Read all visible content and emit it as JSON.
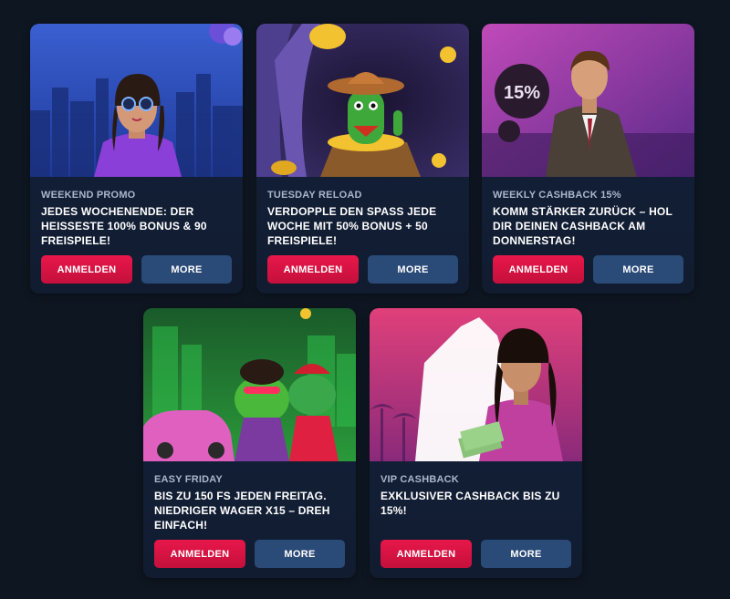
{
  "promotions": [
    {
      "tag": "WEEKEND PROMO",
      "title": "JEDES WOCHENENDE: DER HEISSESTE 100% BONUS & 90 FREISPIELE!",
      "primary_label": "ANMELDEN",
      "secondary_label": "MORE",
      "art_icon": "woman-sunglasses-city-icon"
    },
    {
      "tag": "TUESDAY RELOAD",
      "title": "VERDOPPLE DEN SPASS JEDE WOCHE MIT 50% BONUS + 50 FREISPIELE!",
      "primary_label": "ANMELDEN",
      "secondary_label": "MORE",
      "art_icon": "cactus-cowboy-gold-icon"
    },
    {
      "tag": "WEEKLY CASHBACK 15%",
      "title": "KOMM STÄRKER ZURÜCK – HOL DIR DEINEN CASHBACK AM DONNERSTAG!",
      "primary_label": "ANMELDEN",
      "secondary_label": "MORE",
      "art_icon": "businessman-balloon-icon",
      "art_text": "15%"
    },
    {
      "tag": "EASY FRIDAY",
      "title": "BIS ZU 150 FS JEDEN FREITAG. NIEDRIGER WAGER X15 – DREH EINFACH!",
      "primary_label": "ANMELDEN",
      "secondary_label": "MORE",
      "art_icon": "frogs-pink-car-icon"
    },
    {
      "tag": "VIP CASHBACK",
      "title": "EXKLUSIVER CASHBACK BIS ZU 15%!",
      "primary_label": "ANMELDEN",
      "secondary_label": "MORE",
      "art_icon": "woman-money-pink-icon"
    }
  ],
  "colors": {
    "page_bg": "#0e1621",
    "card_bg": "#13223c",
    "primary_button": "#e8174a",
    "secondary_button": "#2a4a78"
  }
}
